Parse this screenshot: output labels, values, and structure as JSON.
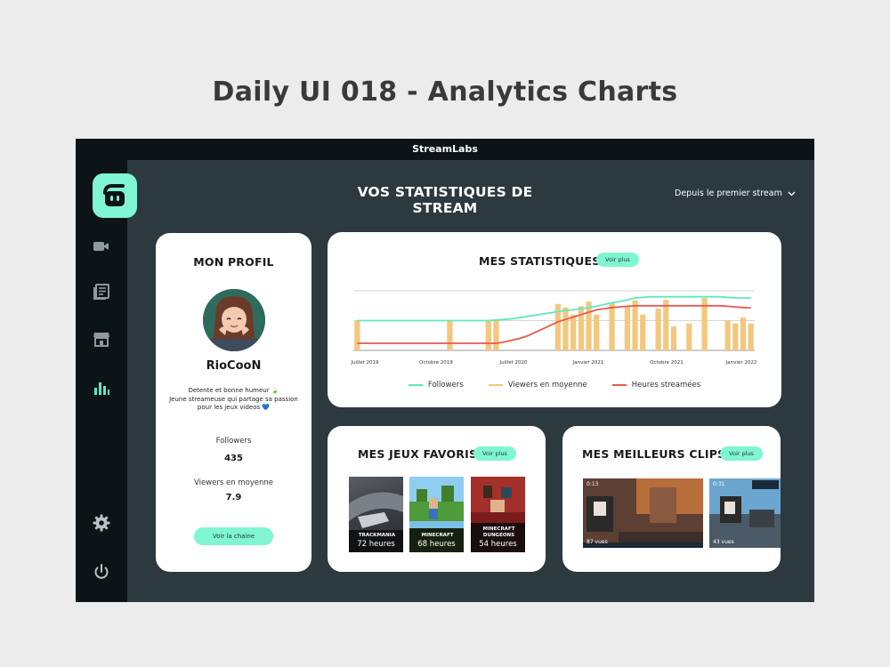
{
  "page": {
    "title": "Daily UI 018 - Analytics Charts"
  },
  "window": {
    "title": "StreamLabs"
  },
  "main": {
    "title": "VOS STATISTIQUES DE STREAM",
    "period": "Depuis le premier stream"
  },
  "sidebar": {
    "items": [
      {
        "name": "video",
        "icon": "video-camera-icon"
      },
      {
        "name": "news",
        "icon": "newspaper-icon"
      },
      {
        "name": "store",
        "icon": "store-icon"
      },
      {
        "name": "analytics",
        "icon": "bar-chart-icon",
        "active": true
      },
      {
        "name": "settings",
        "icon": "gear-icon"
      },
      {
        "name": "power",
        "icon": "power-icon"
      }
    ]
  },
  "profile": {
    "title": "MON PROFIL",
    "username": "RioCooN",
    "bio": [
      "Detente et bonne humeur 🍃",
      "Jeune streameuse qui partage sa passion",
      "pour les jeux videos 💙"
    ],
    "followers_label": "Followers",
    "followers_value": "435",
    "viewers_label": "Viewers en moyenne",
    "viewers_value": "7.9",
    "channel_button": "Voir la chaine"
  },
  "stats": {
    "title": "MES STATISTIQUES",
    "more_button": "Voir plus"
  },
  "games": {
    "title": "MES JEUX FAVORIS",
    "more_button": "Voir plus",
    "items": [
      {
        "name": "TRACKMANIA",
        "hours": "72 heures"
      },
      {
        "name": "MINECRAFT",
        "hours": "68 heures"
      },
      {
        "name": "MINECRAFT\nDUNGEONS",
        "hours": "54 heures"
      }
    ]
  },
  "clips": {
    "title": "MES MEILLEURS CLIPS",
    "more_button": "Voir plus",
    "items": [
      {
        "duration": "0:13",
        "views": "87 vues"
      },
      {
        "duration": "0:31",
        "views": "43 vues"
      }
    ]
  },
  "chart_data": {
    "type": "bar",
    "x_ticks": [
      "Juillet 2019",
      "Octobre 2019",
      "Juillet 2020",
      "Janvier 2021",
      "Octobre 2021",
      "Janvier 2022"
    ],
    "legend": "bottom",
    "grid": true,
    "ylim": [
      0,
      100
    ],
    "series": [
      {
        "name": "Followers",
        "type": "line",
        "color": "#5ee8c0",
        "values": [
          50,
          50,
          50,
          50,
          50,
          50,
          50,
          50,
          50,
          50,
          50,
          50,
          50,
          50,
          50,
          50,
          50,
          50,
          51,
          52,
          53,
          55,
          57,
          59,
          61,
          63,
          65,
          67,
          68,
          70,
          72,
          74,
          77,
          80,
          82,
          85,
          88,
          89,
          90,
          90,
          90,
          90,
          90,
          90,
          90,
          90,
          90,
          90,
          89,
          88,
          88,
          88
        ]
      },
      {
        "name": "Viewers en moyenne",
        "type": "bar",
        "color": "#f3c77e",
        "values": [
          50,
          0,
          0,
          0,
          0,
          0,
          0,
          0,
          0,
          0,
          0,
          0,
          50,
          0,
          0,
          0,
          0,
          50,
          50,
          0,
          0,
          0,
          0,
          0,
          0,
          0,
          78,
          72,
          60,
          74,
          82,
          60,
          0,
          80,
          0,
          74,
          84,
          60,
          0,
          70,
          85,
          40,
          0,
          45,
          0,
          88,
          0,
          0,
          50,
          45,
          55,
          45
        ]
      },
      {
        "name": "Heures streamées",
        "type": "line",
        "color": "#e65a4b",
        "values": [
          12,
          12,
          12,
          12,
          12,
          12,
          12,
          12,
          12,
          12,
          12,
          12,
          12,
          12,
          12,
          12,
          12,
          12,
          12,
          14,
          17,
          20,
          24,
          30,
          36,
          42,
          48,
          52,
          56,
          60,
          64,
          68,
          70,
          72,
          73,
          74,
          75,
          75,
          75,
          75,
          75,
          75,
          75,
          75,
          75,
          75,
          75,
          75,
          74,
          73,
          72,
          71
        ]
      }
    ]
  }
}
